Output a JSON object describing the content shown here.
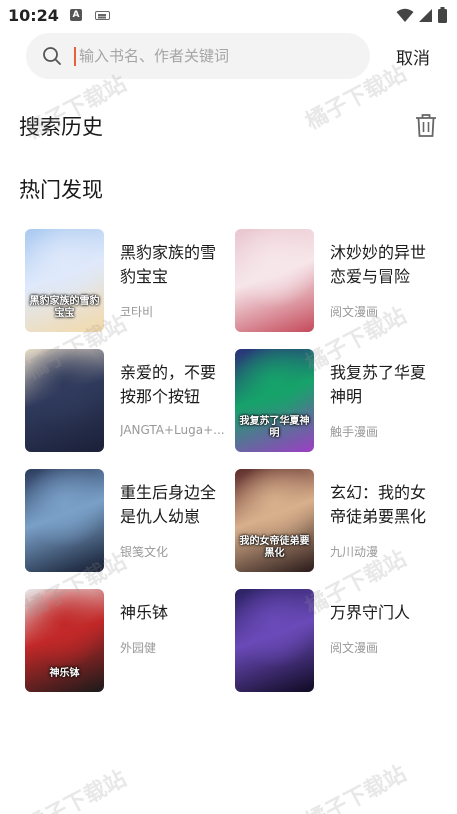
{
  "status_bar": {
    "time": "10:24",
    "a_icon": "A"
  },
  "search": {
    "placeholder": "输入书名、作者关键词",
    "value": "",
    "cancel_label": "取消"
  },
  "history": {
    "title": "搜索历史"
  },
  "hot": {
    "title": "热门发现",
    "items": [
      {
        "name": "黑豹家族的雪豹宝宝",
        "author": "코타비",
        "cover_colors": [
          "#a9c9f0",
          "#dfe9fb",
          "#f3d9a8"
        ]
      },
      {
        "name": "沐妙妙的异世恋爱与冒险",
        "author": "阅文漫画",
        "cover_colors": [
          "#e9c6cf",
          "#f6e6ea",
          "#c44a5a"
        ]
      },
      {
        "name": "亲爱的，不要按那个按钮",
        "author": "JANGTA+Luga+...",
        "cover_colors": [
          "#e9dcc8",
          "#2f3a5c",
          "#1b2038"
        ]
      },
      {
        "name": "我复苏了华夏神明",
        "author": "触手漫画",
        "cover_colors": [
          "#2a2f7a",
          "#16a36a",
          "#9d3ec4"
        ]
      },
      {
        "name": "重生后身边全是仇人幼崽",
        "author": "银笺文化",
        "cover_colors": [
          "#2a3a5c",
          "#7aa0c8",
          "#121a2e"
        ]
      },
      {
        "name": "玄幻：我的女帝徒弟要黑化",
        "author": "九川动漫",
        "cover_colors": [
          "#5a2a2a",
          "#d9b08c",
          "#2a1a1a"
        ]
      },
      {
        "name": "神乐钵",
        "author": "外园健",
        "cover_colors": [
          "#e8e8e8",
          "#c22828",
          "#1a1a1a"
        ]
      },
      {
        "name": "万界守门人",
        "author": "阅文漫画",
        "cover_colors": [
          "#2a2060",
          "#6a4ab8",
          "#0e0a22"
        ]
      }
    ],
    "cover_titles": [
      "黑豹家族的雪豹宝宝",
      "",
      "",
      "我复苏了华夏神明",
      "",
      "我的女帝徒弟要黑化",
      "神乐钵",
      ""
    ]
  },
  "watermark": "橘子下载站",
  "colors": {
    "caret": "#e8613c",
    "secondary_text": "#999999",
    "search_bg": "#f3f3f3"
  }
}
